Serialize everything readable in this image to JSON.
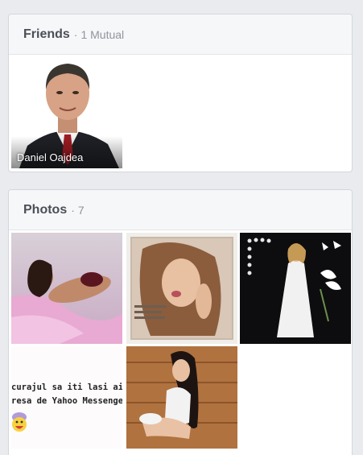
{
  "friends": {
    "title": "Friends",
    "separator": "·",
    "mutual_text": "1 Mutual",
    "items": [
      {
        "name": "Daniel Oajdea"
      }
    ]
  },
  "photos": {
    "title": "Photos",
    "separator": "·",
    "count_text": "7",
    "meme_text": {
      "line1": "curajul sa iti lasi aici",
      "line2": "resa de Yahoo Messenger"
    }
  },
  "colors": {
    "page_background": "#e9ebee",
    "card_header": "#f6f7f9",
    "title_text": "#4b4f56",
    "meta_text": "#90949c"
  },
  "icons": [
    "emoji-face-icon"
  ]
}
